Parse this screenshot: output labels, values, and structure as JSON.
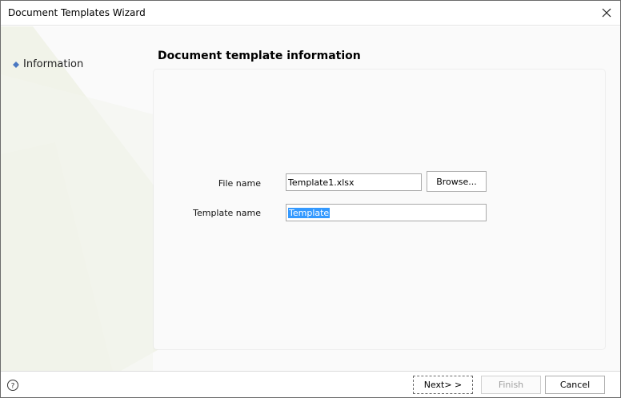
{
  "window": {
    "title": "Document Templates Wizard"
  },
  "nav": {
    "items": [
      {
        "label": "Information"
      }
    ]
  },
  "page": {
    "title": "Document template information"
  },
  "form": {
    "file_name_label": "File name",
    "file_name_value": "Template1.xlsx",
    "browse_label": "Browse...",
    "template_name_label": "Template name",
    "template_name_value": "Template"
  },
  "footer": {
    "help_glyph": "?",
    "next_label": "Next> >",
    "finish_label": "Finish",
    "cancel_label": "Cancel"
  },
  "colors": {
    "accent_bullet": "#4a78c2",
    "selection": "#3399ff"
  },
  "icons": {
    "close": "close-icon",
    "help": "help-icon",
    "bullet": "bullet-icon"
  }
}
